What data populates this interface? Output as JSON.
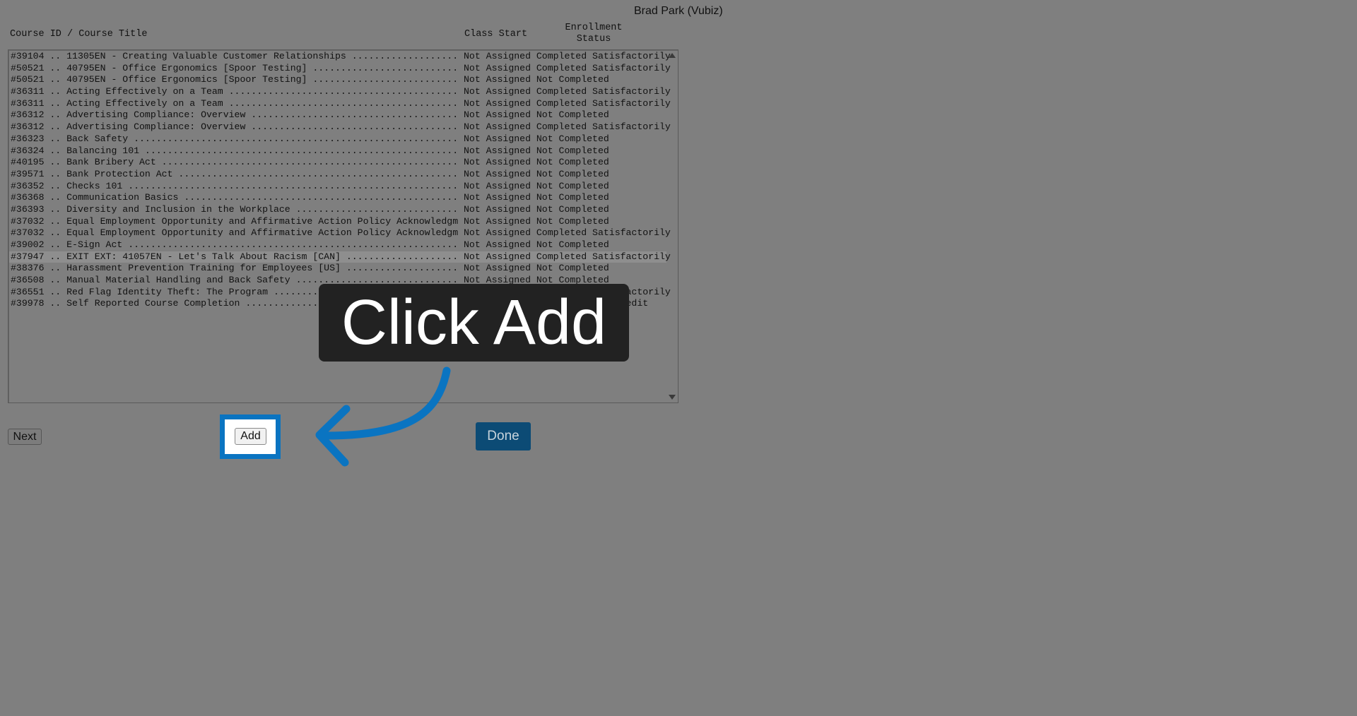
{
  "user": {
    "name": "Brad Park (Vubiz)"
  },
  "columns": {
    "title": "Course ID / Course Title",
    "class_start": "Class Start",
    "status": "Enrollment\nStatus"
  },
  "courses": [
    "#39104 .. 11305EN - Creating Valuable Customer Relationships ................... Not Assigned Completed Satisfactorily",
    "#50521 .. 40795EN - Office Ergonomics [Spoor Testing] .......................... Not Assigned Completed Satisfactorily",
    "#50521 .. 40795EN - Office Ergonomics [Spoor Testing] .......................... Not Assigned Not Completed",
    "#36311 .. Acting Effectively on a Team ......................................... Not Assigned Completed Satisfactorily",
    "#36311 .. Acting Effectively on a Team ......................................... Not Assigned Completed Satisfactorily",
    "#36312 .. Advertising Compliance: Overview ..................................... Not Assigned Not Completed",
    "#36312 .. Advertising Compliance: Overview ..................................... Not Assigned Completed Satisfactorily",
    "#36323 .. Back Safety .......................................................... Not Assigned Not Completed",
    "#36324 .. Balancing 101 ........................................................ Not Assigned Not Completed",
    "#40195 .. Bank Bribery Act ..................................................... Not Assigned Not Completed",
    "#39571 .. Bank Protection Act .................................................. Not Assigned Not Completed",
    "#36352 .. Checks 101 ........................................................... Not Assigned Not Completed",
    "#36368 .. Communication Basics ................................................. Not Assigned Not Completed",
    "#36393 .. Diversity and Inclusion in the Workplace ............................. Not Assigned Not Completed",
    "#37032 .. Equal Employment Opportunity and Affirmative Action Policy Acknowledgm Not Assigned Not Completed",
    "#37032 .. Equal Employment Opportunity and Affirmative Action Policy Acknowledgm Not Assigned Completed Satisfactorily",
    "#39002 .. E-Sign Act ........................................................... Not Assigned Not Completed",
    "#37947 .. EXIT EXT: 41057EN - Let's Talk About Racism [CAN] .................... Not Assigned Completed Satisfactorily",
    "#38376 .. Harassment Prevention Training for Employees [US] .................... Not Assigned Not Completed",
    "#36508 .. Manual Material Handling and Back Safety ............................. Not Assigned Not Completed",
    "#36551 .. Red Flag Identity Theft: The Program ................................. Not Assigned Completed Satisfactorily",
    "#39978 .. Self Reported Course Completion ...................................... Not Assigned Self Reported Credit"
  ],
  "selected_index": 17,
  "buttons": {
    "next": "Next",
    "add": "Add",
    "done": "Done"
  },
  "callout": {
    "text": "Click Add"
  },
  "colors": {
    "highlight": "#0a74c1",
    "done_bg": "#0c4b75",
    "callout_bg": "#222222"
  }
}
